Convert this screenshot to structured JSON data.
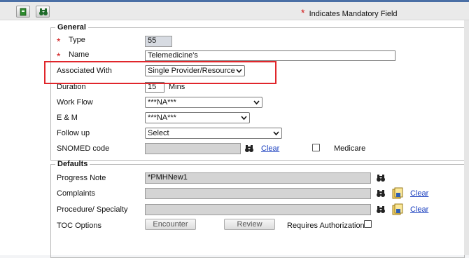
{
  "toolbar": {
    "new_icon": "new-document-icon",
    "find_icon": "binoculars-icon",
    "mandatory_star": "*",
    "mandatory_text": "Indicates Mandatory Field"
  },
  "general": {
    "legend": "General",
    "type_label": "Type",
    "type_value": "55",
    "name_label": "Name",
    "name_value": "Telemedicine's",
    "associated_label": "Associated With",
    "associated_value": "Single Provider/Resource",
    "duration_label": "Duration",
    "duration_value": "15",
    "duration_unit": "Mins",
    "workflow_label": "Work Flow",
    "workflow_value": "***NA***",
    "em_label": "E & M",
    "em_value": "***NA***",
    "followup_label": "Follow up",
    "followup_value": "Select",
    "snomed_label": "SNOMED code",
    "snomed_value": "",
    "clear_label": "Clear",
    "medicare_label": "Medicare",
    "required_marker": "*"
  },
  "defaults": {
    "legend": "Defaults",
    "progress_label": "Progress Note",
    "progress_value": "*PMHNew1",
    "complaints_label": "Complaints",
    "complaints_value": "",
    "procedure_label": "Procedure/ Specialty",
    "procedure_value": "",
    "clear_label": "Clear",
    "toc_label": "TOC Options",
    "encounter_label": "Encounter",
    "review_label": "Review",
    "requires_auth_label": "Requires Authorization"
  },
  "colors": {
    "highlight": "#e0262b",
    "link": "#1a3fbf",
    "required": "#d01010"
  }
}
